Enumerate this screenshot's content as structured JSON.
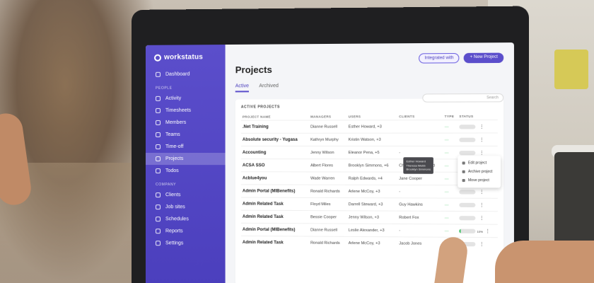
{
  "app": {
    "logo_text": "workstatus"
  },
  "sidebar": {
    "top_items": [
      {
        "label": "Dashboard",
        "icon": "grid-icon"
      }
    ],
    "people_label": "PEOPLE",
    "people_items": [
      {
        "label": "Activity",
        "icon": "chart-icon"
      },
      {
        "label": "Timesheets",
        "icon": "clock-icon"
      },
      {
        "label": "Members",
        "icon": "users-icon"
      },
      {
        "label": "Teams",
        "icon": "team-icon"
      },
      {
        "label": "Time-off",
        "icon": "calendar-icon"
      },
      {
        "label": "Projects",
        "icon": "folder-icon",
        "active": true
      },
      {
        "label": "Todos",
        "icon": "checklist-icon"
      }
    ],
    "company_label": "COMPANY",
    "company_items": [
      {
        "label": "Clients",
        "icon": "client-icon"
      },
      {
        "label": "Job sites",
        "icon": "pin-icon"
      },
      {
        "label": "Schedules",
        "icon": "schedule-icon"
      },
      {
        "label": "Reports",
        "icon": "report-icon"
      },
      {
        "label": "Settings",
        "icon": "gear-icon"
      }
    ]
  },
  "header": {
    "title": "Projects",
    "integrated_label": "Integrated with",
    "new_project_label": "+ New Project"
  },
  "tabs": [
    {
      "label": "Active",
      "active": true
    },
    {
      "label": "Archived",
      "active": false
    }
  ],
  "search": {
    "placeholder": "Search"
  },
  "table": {
    "card_title": "ACTIVE PROJECTS",
    "columns": {
      "project": "PROJECT NAME",
      "managers": "MANAGERS",
      "users": "USERS",
      "clients": "CLIENTS",
      "type": "TYPE",
      "status": "STATUS"
    },
    "rows": [
      {
        "project": ".Net Training",
        "manager": "Dianne Russell",
        "users": "Esther Howard, +3",
        "client": "",
        "type": "",
        "status": 0
      },
      {
        "project": "Absolute security - Yugasa",
        "manager": "Kathryn Murphy",
        "users": "Kristin Watson, +3",
        "client": "",
        "type": "",
        "status": 0
      },
      {
        "project": "Accounting",
        "manager": "Jenny Wilson",
        "users": "Eleanor Pena, +5",
        "client": "-",
        "type": "",
        "status": 0
      },
      {
        "project": "ACSA SSO",
        "manager": "Albert Flores",
        "users": "Brooklyn Simmons, +6",
        "client": "Christopher Richard",
        "type": "",
        "status": 0
      },
      {
        "project": "Acblue4you",
        "manager": "Wade Warren",
        "users": "Ralph Edwards, +4",
        "client": "Jane Cooper",
        "type": "",
        "status": 0
      },
      {
        "project": "Admin Portal (MIBenefits)",
        "manager": "Ronald Richards",
        "users": "Arlene McCoy, +3",
        "client": "-",
        "type": "",
        "status": 0
      },
      {
        "project": "Admin Related Task",
        "manager": "Floyd Miles",
        "users": "Darrell Steward, +3",
        "client": "Guy Hawkins",
        "type": "",
        "status": 0
      },
      {
        "project": "Admin Related Task",
        "manager": "Bessie Cooper",
        "users": "Jenny Wilson, +3",
        "client": "Robert Fox",
        "type": "",
        "status": 0
      },
      {
        "project": "Admin Portal (MIBenefits)",
        "manager": "Dianne Russell",
        "users": "Leslie Alexander, +3",
        "client": "-",
        "type": "",
        "status": 10
      },
      {
        "project": "Admin Related Task",
        "manager": "Ronald Richards",
        "users": "Arlene McCoy, +3",
        "client": "Jacob Jones",
        "type": "",
        "status": 0
      }
    ]
  },
  "users_popover": {
    "lines": [
      "Esther Howard",
      "Theresa Webb",
      "Brooklyn Simmons"
    ]
  },
  "row_menu": {
    "items": [
      {
        "label": "Edit project",
        "icon": "edit-icon"
      },
      {
        "label": "Archive project",
        "icon": "archive-icon"
      },
      {
        "label": "Move project",
        "icon": "move-icon"
      }
    ]
  }
}
